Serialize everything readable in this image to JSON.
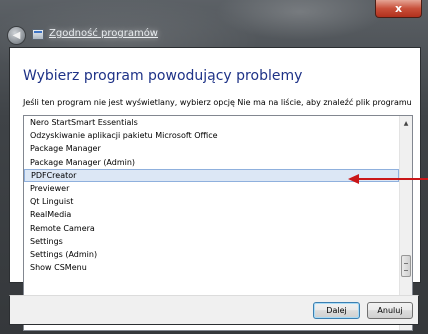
{
  "window": {
    "title": "Zgodność programów",
    "close_glyph": "x",
    "back_glyph": "◀"
  },
  "dialog": {
    "heading": "Wybierz program powodujący problemy",
    "instruction": "Jeśli ten program nie jest wyświetlany, wybierz opcję Nie ma na liście, aby znaleźć plik programu"
  },
  "program_list": {
    "items": [
      "Nero StartSmart Essentials",
      "Odzyskiwanie aplikacji pakietu Microsoft Office",
      "Package Manager",
      "Package Manager (Admin)",
      "PDFCreator",
      "Previewer",
      "Qt Linguist",
      "RealMedia",
      "Remote Camera",
      "Settings",
      "Settings (Admin)",
      "Show CSMenu"
    ],
    "selected": "PDFCreator"
  },
  "scrollbar": {
    "up_glyph": "▲",
    "down_glyph": "▼"
  },
  "buttons": {
    "next": "Dalej",
    "cancel": "Anuluj"
  },
  "colors": {
    "heading": "#1e3287",
    "annotation_arrow": "#c91618",
    "selection": "#dce7f5"
  }
}
